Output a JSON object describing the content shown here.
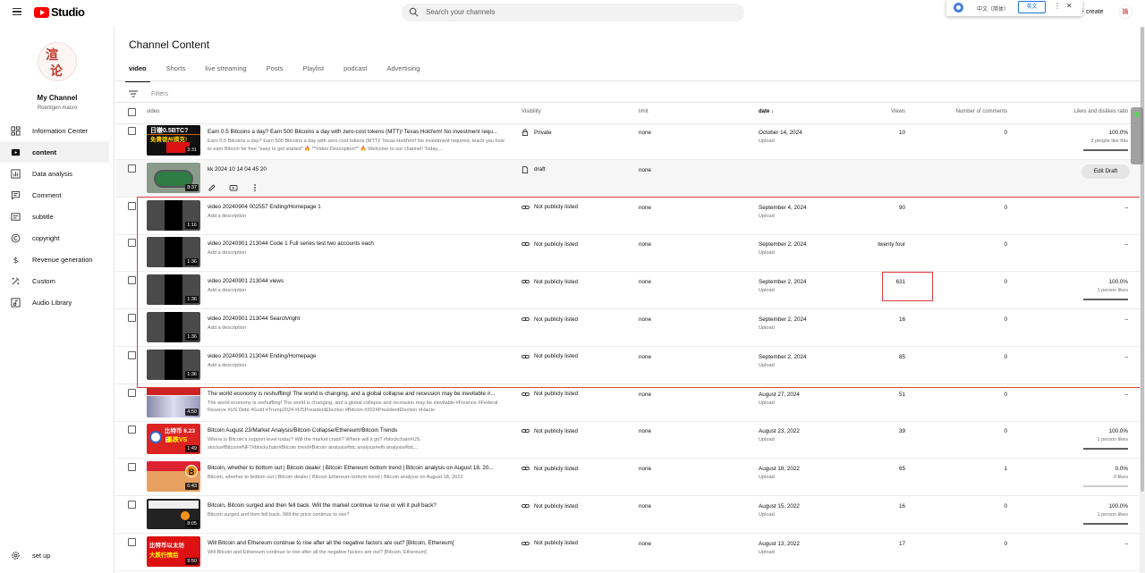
{
  "app": {
    "logo_text": "Studio",
    "create_label": "create"
  },
  "search": {
    "placeholder": "Search your channels"
  },
  "translate_bar": {
    "source_lang": "中文（简体）",
    "target_lang": "英文"
  },
  "channel": {
    "name": "My Channel",
    "handle": "Roentgen macro"
  },
  "sidebar": {
    "items": [
      {
        "label": "Information Center",
        "icon": "dashboard-icon"
      },
      {
        "label": "content",
        "icon": "content-icon",
        "active": true
      },
      {
        "label": "Data analysis",
        "icon": "analytics-icon"
      },
      {
        "label": "Comment",
        "icon": "comment-icon"
      },
      {
        "label": "subtitle",
        "icon": "subtitle-icon"
      },
      {
        "label": "copyright",
        "icon": "copyright-icon"
      },
      {
        "label": "Revenue generation",
        "icon": "dollar-icon"
      },
      {
        "label": "Custom",
        "icon": "customize-icon"
      },
      {
        "label": "Audio Library",
        "icon": "audio-library-icon"
      }
    ],
    "settings_label": "set up"
  },
  "page": {
    "title": "Channel Content",
    "tabs": [
      "video",
      "Shorts",
      "live streaming",
      "Posts",
      "Playlist",
      "podcast",
      "Advertising"
    ],
    "filter_placeholder": "Filters"
  },
  "table": {
    "headers": {
      "video": "video",
      "visibility": "Visibility",
      "limit": "limit",
      "date": "date",
      "views": "Views",
      "comments": "Number of comments",
      "ratio": "Likes and dislikes ratio"
    },
    "rows": [
      {
        "title": "Earn 0.5 Bitcoins a day? Earn 500 Bitcoins a day with zero-cost tokens (MTT)! Texas Hold'em! No investment requ...",
        "desc": "Earn 0.5 Bitcoins a day? Earn 500 Bitcoins a day with zero-cost tokens (MTT)! Texas Hold'em! No investment required, teach you how to earn Bitcoin for free \"easy to get started\" 🔥 **Video Description** 🔥 Welcome to our channel! Today,...",
        "duration": "3:31",
        "visibility": "Private",
        "vis_icon": "lock-icon",
        "limit": "none",
        "date": "October 14, 2024",
        "date_sub": "Upload",
        "views": "10",
        "comments": "0",
        "ratio": "100.0%",
        "ratio_sub": "3 people like this",
        "ratio_fill": 1.0,
        "thumb": "red"
      },
      {
        "title": "kk 2024 10 14 04 45 20",
        "desc": "",
        "duration": "8:37",
        "visibility": "draft",
        "vis_icon": "draft-icon",
        "limit": "none",
        "draft": true,
        "edit_draft": "Edit Draft",
        "thumb": "poker"
      },
      {
        "title": "video 20240904 002557 Ending/Homepage 1",
        "desc": "Add a description",
        "duration": "1:16",
        "visibility": "Not publicly listed",
        "vis_icon": "link-icon",
        "limit": "none",
        "date": "September 4, 2024",
        "date_sub": "Upload",
        "views": "90",
        "comments": "0",
        "ratio": "–",
        "thumb": "dark"
      },
      {
        "title": "video 20240901 213044 Code 1 Full series test two accounts each",
        "desc": "Add a description",
        "duration": "1:36",
        "visibility": "Not publicly listed",
        "vis_icon": "link-icon",
        "limit": "none",
        "date": "September 2, 2024",
        "date_sub": "Upload",
        "views": "twenty four",
        "comments": "0",
        "ratio": "–",
        "thumb": "dark"
      },
      {
        "title": "video 20240901 213044 views",
        "desc": "Add a description",
        "duration": "1:36",
        "visibility": "Not publicly listed",
        "vis_icon": "link-icon",
        "limit": "none",
        "date": "September 2, 2024",
        "date_sub": "Upload",
        "views": "631",
        "comments": "0",
        "ratio": "100.0%",
        "ratio_sub": "1 person likes",
        "ratio_fill": 1.0,
        "thumb": "dark"
      },
      {
        "title": "video 20240901 213044 Search/right",
        "desc": "Add a description",
        "duration": "1:36",
        "visibility": "Not publicly listed",
        "vis_icon": "link-icon",
        "limit": "none",
        "date": "September 2, 2024",
        "date_sub": "Upload",
        "views": "16",
        "comments": "0",
        "ratio": "–",
        "thumb": "dark"
      },
      {
        "title": "video 20240901 213044 Ending/Homepage",
        "desc": "Add a description",
        "duration": "1:36",
        "visibility": "Not publicly listed",
        "vis_icon": "link-icon",
        "limit": "none",
        "date": "September 2, 2024",
        "date_sub": "Upload",
        "views": "85",
        "comments": "0",
        "ratio": "–",
        "thumb": "dark"
      },
      {
        "title": "The world economy is reshuffling! The world is changing, and a global collapse and recession may be inevitable #...",
        "desc": "The world economy is reshuffling! The world is changing, and a global collapse and recession may be inevitable #Finance #Federal Reserve #US Debt #Gold #Trump2024 #USPresidentElection #Bitcoin #2024PresidentElection #Harris",
        "duration": "4:50",
        "visibility": "Not publicly listed",
        "vis_icon": "link-icon",
        "limit": "none",
        "date": "August 27, 2024",
        "date_sub": "Upload",
        "views": "51",
        "comments": "0",
        "ratio": "–",
        "thumb": "news"
      },
      {
        "title": "Bitcoin August 23/Market Analysis/Bitcoin Collapse/Ethereum/Bitcoin Trends",
        "desc": "Where is Bitcoin's support level today? Will the market crash? Where will it go? #blockchain#US stocks#Bitcoin#NFT#blockchain#Bitcoin trend#Bitcoin analysis#btc analysis#eth analysis#btc...",
        "duration": "1:49",
        "visibility": "Not publicly listed",
        "vis_icon": "link-icon",
        "limit": "none",
        "date": "August 23, 2022",
        "date_sub": "Upload",
        "views": "39",
        "comments": "0",
        "ratio": "100.0%",
        "ratio_sub": "1 person likes",
        "ratio_fill": 1.0,
        "thumb": "btc-red"
      },
      {
        "title": "Bitcoin, whether to bottom out | Bitcoin dealer | Bitcoin Ethereum bottom trend | Bitcoin analysis on August 18, 20...",
        "desc": "Bitcoin, whether to bottom out | Bitcoin dealer | Bitcoin Ethereum bottom trend | Bitcoin analysis on August 18, 2022",
        "duration": "6:43",
        "visibility": "Not publicly listed",
        "vis_icon": "link-icon",
        "limit": "none",
        "date": "August 18, 2022",
        "date_sub": "Upload",
        "views": "65",
        "comments": "1",
        "ratio": "0.0%",
        "ratio_sub": "0 likes",
        "ratio_fill": 0.0,
        "thumb": "btc-orange"
      },
      {
        "title": "Bitcoin, Bitcoin surged and then fell back. Will the market continue to rise or will it pull back?",
        "desc": "Bitcoin surged and then fell back. Will the price continue to rise?",
        "duration": "8:05",
        "visibility": "Not publicly listed",
        "vis_icon": "link-icon",
        "limit": "none",
        "date": "August 15, 2022",
        "date_sub": "Upload",
        "views": "16",
        "comments": "0",
        "ratio": "100.0%",
        "ratio_sub": "1 person likes",
        "ratio_fill": 1.0,
        "thumb": "btc-dark"
      },
      {
        "title": "Will Bitcoin and Ethereum continue to rise after all the negative factors are out? [Bitcoin, Ethereum]",
        "desc": "Will Bitcoin and Ethereum continue to rise after all the negative factors are out? [Bitcoin, Ethereum]",
        "duration": "9:50",
        "visibility": "Not publicly listed",
        "vis_icon": "link-icon",
        "limit": "none",
        "date": "August 13, 2022",
        "date_sub": "Upload",
        "views": "17",
        "comments": "0",
        "ratio": "–",
        "thumb": "red2"
      }
    ]
  },
  "colors": {
    "brand": "#ff0000",
    "highlight": "#e03a3a",
    "link": "#1a73e8"
  }
}
